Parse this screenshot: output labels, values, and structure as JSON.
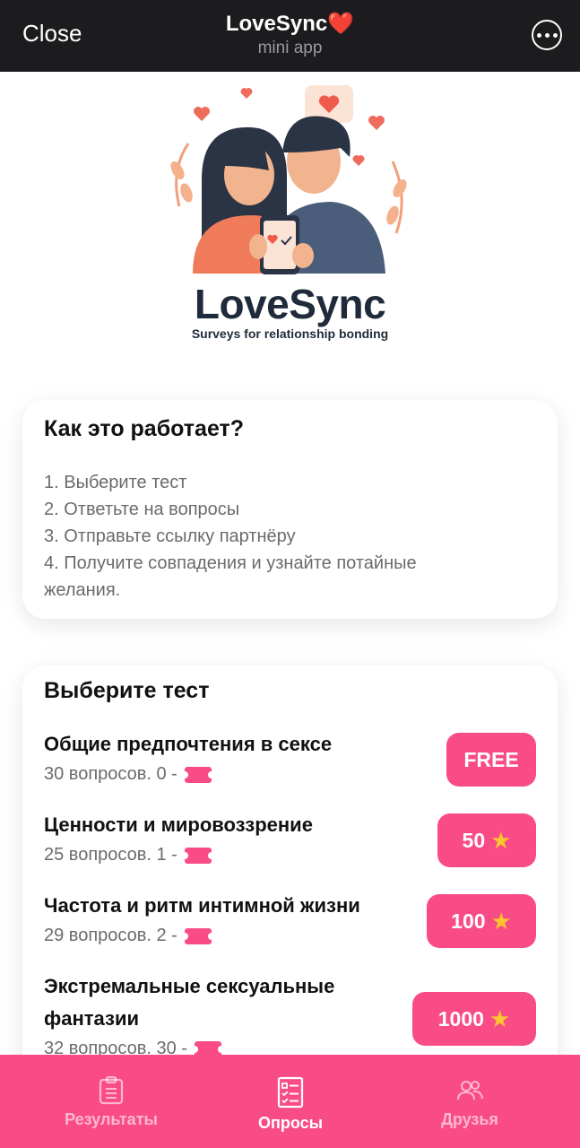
{
  "topbar": {
    "close_label": "Close",
    "title": "LoveSync❤️",
    "subtitle": "mini app"
  },
  "logo": {
    "name": "LoveSync",
    "tagline": "Surveys for relationship bonding"
  },
  "how_it_works": {
    "title": "Как это работает?",
    "steps": [
      "1. Выберите тест",
      "2. Ответьте на вопросы",
      "3. Отправьте ссылку партнёру",
      "4. Получите совпадения и узнайте потайные",
      "желания."
    ]
  },
  "choose_test": {
    "title": "Выберите тест",
    "tests": [
      {
        "name": "Общие предпочтения в сексе",
        "meta": "30 вопросов. 0 -",
        "price": "FREE",
        "star": false
      },
      {
        "name": "Ценности и мировоззрение",
        "meta": "25 вопросов. 1 -",
        "price": "50",
        "star": true
      },
      {
        "name": "Частота и ритм интимной жизни",
        "meta": "29 вопросов. 2 -",
        "price": "100",
        "star": true
      },
      {
        "name": "Экстремальные сексуальные",
        "name2": "фантазии",
        "meta": "32 вопросов. 30 -",
        "price": "1000",
        "star": true
      }
    ]
  },
  "tabs": [
    {
      "label": "Результаты",
      "icon": "clipboard-icon",
      "active": false
    },
    {
      "label": "Опросы",
      "icon": "checklist-icon",
      "active": true
    },
    {
      "label": "Друзья",
      "icon": "people-icon",
      "active": false
    }
  ],
  "colors": {
    "accent": "#f94c86",
    "topbar": "#1c1c1e",
    "star": "#ffc531"
  }
}
